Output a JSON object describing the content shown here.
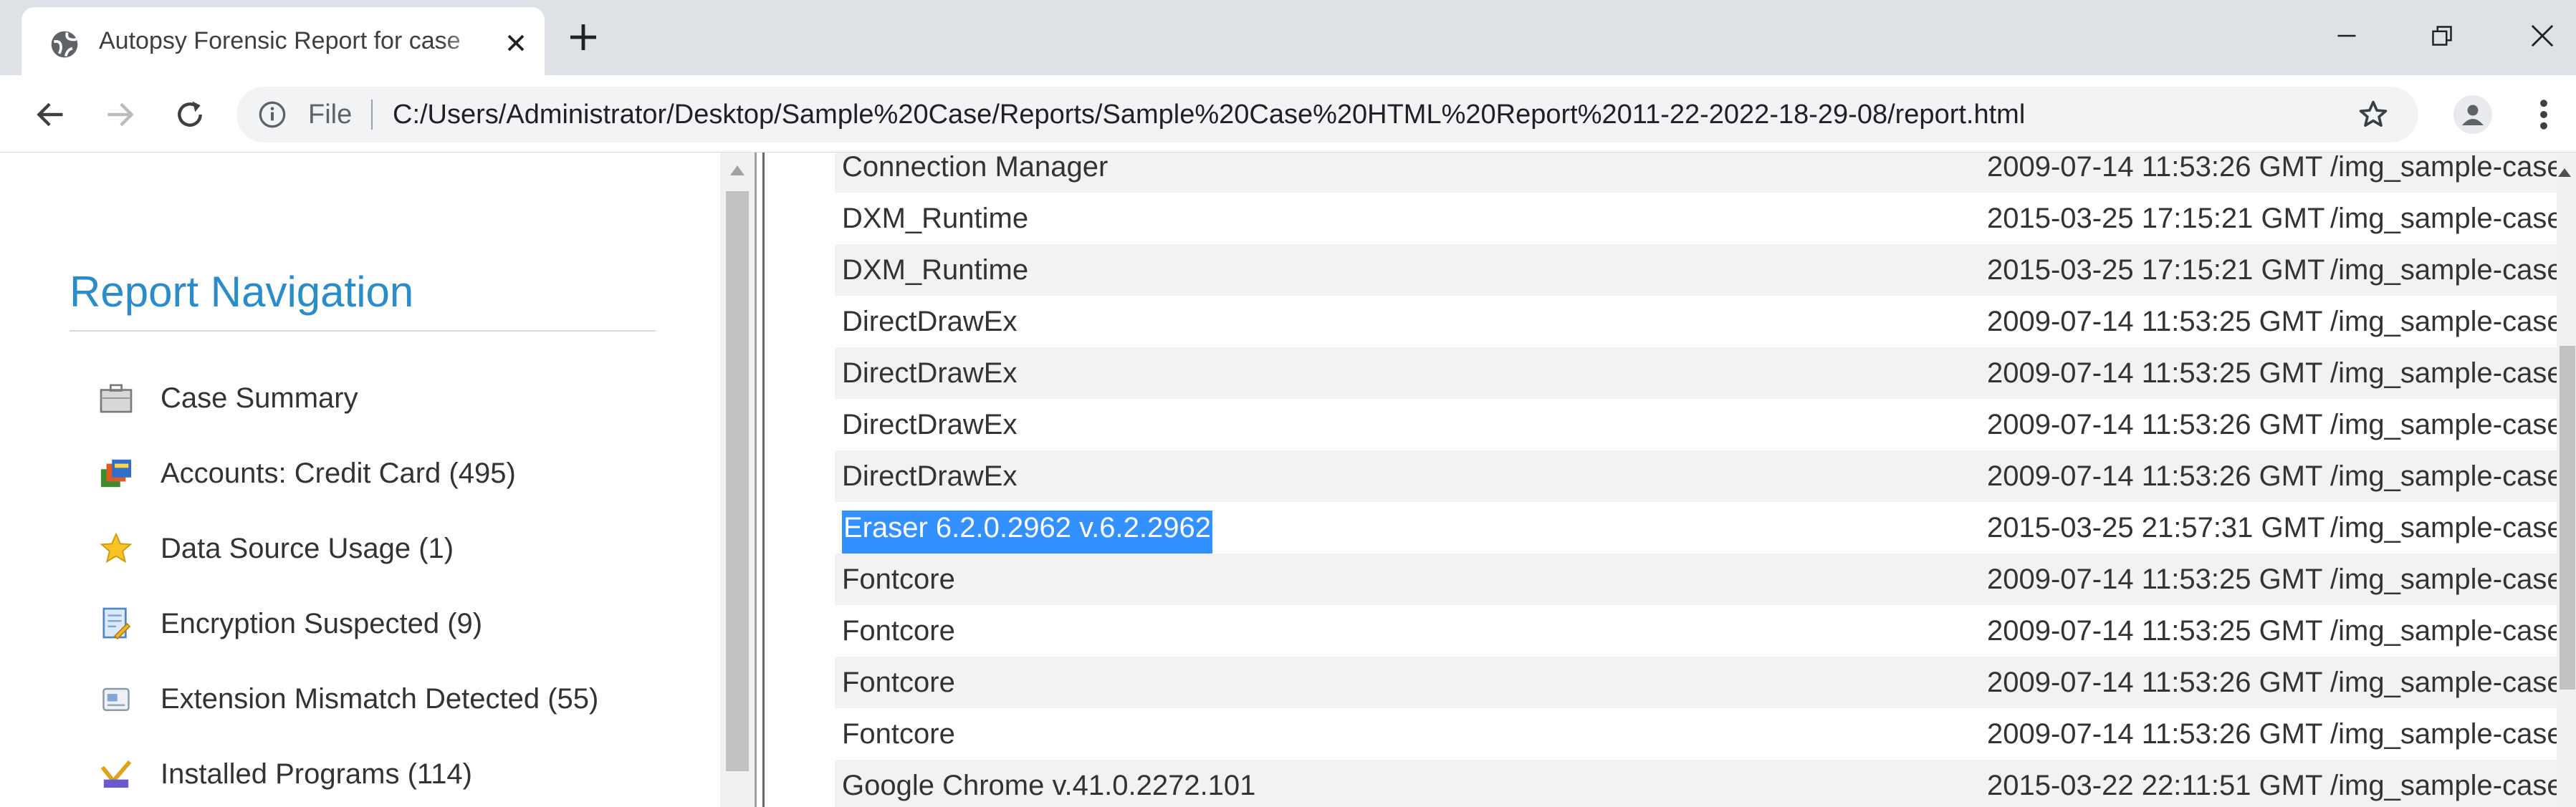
{
  "browser": {
    "tab_title": "Autopsy Forensic Report for case",
    "scheme_label": "File",
    "url": "C:/Users/Administrator/Desktop/Sample%20Case/Reports/Sample%20Case%20HTML%20Report%2011-22-2022-18-29-08/report.html"
  },
  "nav": {
    "heading": "Report Navigation",
    "items": [
      {
        "label": "Case Summary",
        "icon": "briefcase-icon"
      },
      {
        "label": "Accounts: Credit Card (495)",
        "icon": "credit-card-icon"
      },
      {
        "label": "Data Source Usage (1)",
        "icon": "star-icon"
      },
      {
        "label": "Encryption Suspected (9)",
        "icon": "encrypted-file-icon"
      },
      {
        "label": "Extension Mismatch Detected (55)",
        "icon": "mismatch-icon"
      },
      {
        "label": "Installed Programs (114)",
        "icon": "installed-programs-icon"
      }
    ]
  },
  "table": {
    "rows": [
      {
        "name": "Connection Manager",
        "date": "2009-07-14 11:53:26 GMT",
        "path": "/img_sample-case.dd/vo"
      },
      {
        "name": "DXM_Runtime",
        "date": "2015-03-25 17:15:21 GMT",
        "path": "/img_sample-case.dd/vo"
      },
      {
        "name": "DXM_Runtime",
        "date": "2015-03-25 17:15:21 GMT",
        "path": "/img_sample-case.dd/vo"
      },
      {
        "name": "DirectDrawEx",
        "date": "2009-07-14 11:53:25 GMT",
        "path": "/img_sample-case.dd/vo"
      },
      {
        "name": "DirectDrawEx",
        "date": "2009-07-14 11:53:25 GMT",
        "path": "/img_sample-case.dd/vo"
      },
      {
        "name": "DirectDrawEx",
        "date": "2009-07-14 11:53:26 GMT",
        "path": "/img_sample-case.dd/vo"
      },
      {
        "name": "DirectDrawEx",
        "date": "2009-07-14 11:53:26 GMT",
        "path": "/img_sample-case.dd/vo"
      },
      {
        "name": "Eraser 6.2.0.2962 v.6.2.2962",
        "date": "2015-03-25 21:57:31 GMT",
        "path": "/img_sample-case.dd/vo",
        "selected": true
      },
      {
        "name": "Fontcore",
        "date": "2009-07-14 11:53:25 GMT",
        "path": "/img_sample-case.dd/vo"
      },
      {
        "name": "Fontcore",
        "date": "2009-07-14 11:53:25 GMT",
        "path": "/img_sample-case.dd/vo"
      },
      {
        "name": "Fontcore",
        "date": "2009-07-14 11:53:26 GMT",
        "path": "/img_sample-case.dd/vo"
      },
      {
        "name": "Fontcore",
        "date": "2009-07-14 11:53:26 GMT",
        "path": "/img_sample-case.dd/vo"
      },
      {
        "name": "Google Chrome v.41.0.2272.101",
        "date": "2015-03-22 22:11:51 GMT",
        "path": "/img_sample-case.dd/vo"
      }
    ]
  },
  "colors": {
    "heading": "#2a8dc9",
    "selection": "#3390ff",
    "row_alt": "#f2f2f2"
  }
}
